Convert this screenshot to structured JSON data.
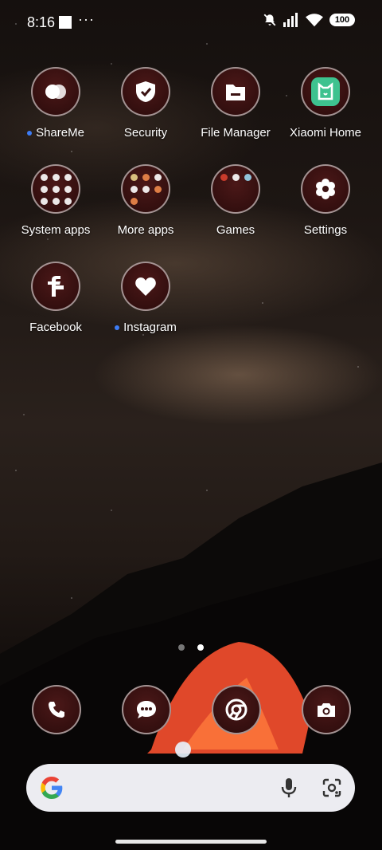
{
  "status_bar": {
    "time": "8:16",
    "overflow": "···",
    "battery": "100",
    "icons": [
      "mute-icon",
      "signal-icon",
      "wifi-icon",
      "battery-icon"
    ]
  },
  "apps": [
    {
      "label": "ShareMe",
      "new_dot": true,
      "icon": "shareme-icon"
    },
    {
      "label": "Security",
      "new_dot": false,
      "icon": "security-shield-icon"
    },
    {
      "label": "File Manager",
      "new_dot": false,
      "icon": "folder-icon"
    },
    {
      "label": "Xiaomi Home",
      "new_dot": false,
      "icon": "xiaomi-home-icon"
    },
    {
      "label": "System apps",
      "new_dot": false,
      "icon": "system-apps-folder-icon"
    },
    {
      "label": "More apps",
      "new_dot": false,
      "icon": "more-apps-folder-icon"
    },
    {
      "label": "Games",
      "new_dot": false,
      "icon": "games-folder-icon"
    },
    {
      "label": "Settings",
      "new_dot": false,
      "icon": "gear-icon"
    },
    {
      "label": "Facebook",
      "new_dot": false,
      "icon": "facebook-icon"
    },
    {
      "label": "Instagram",
      "new_dot": true,
      "icon": "heart-icon"
    }
  ],
  "pager": {
    "pages": 2,
    "active": 2
  },
  "dock": [
    {
      "icon": "phone-icon"
    },
    {
      "icon": "messages-icon"
    },
    {
      "icon": "chrome-icon"
    },
    {
      "icon": "camera-icon"
    }
  ],
  "search_bar": {
    "logo": "google-logo",
    "mic": "mic-icon",
    "lens": "lens-icon",
    "colors": {
      "blue": "#4285F4",
      "red": "#EA4335",
      "yellow": "#FBBC05",
      "green": "#34A853"
    }
  },
  "accent": "#3d7cf5",
  "icon_circle_color": "#3a1212"
}
